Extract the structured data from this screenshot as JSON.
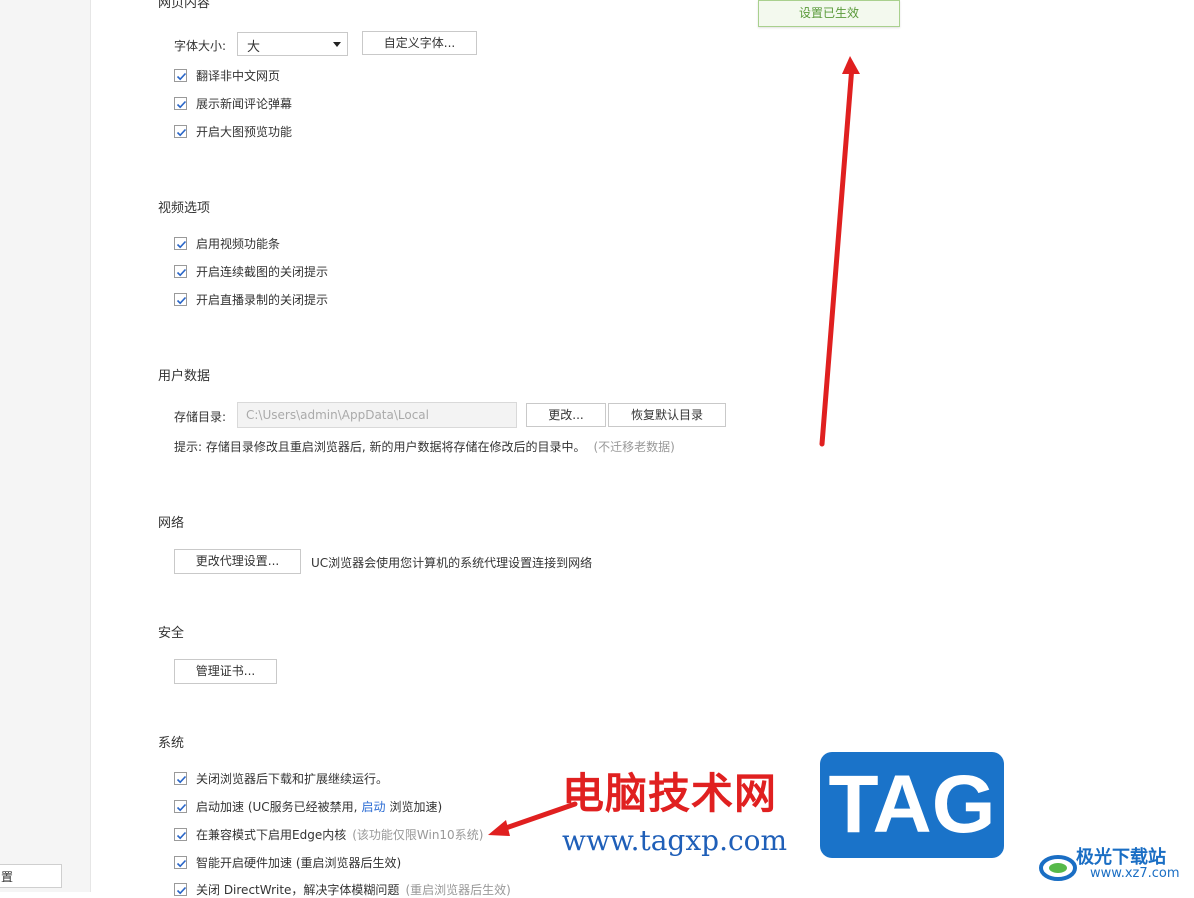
{
  "sidebar": {
    "partial_item_label": "置"
  },
  "toast": {
    "text": "设置已生效"
  },
  "web_content": {
    "title": "网页内容",
    "font_size_label": "字体大小:",
    "font_size_value": "大",
    "custom_font_button": "自定义字体...",
    "options": [
      "翻译非中文网页",
      "展示新闻评论弹幕",
      "开启大图预览功能"
    ]
  },
  "video": {
    "title": "视频选项",
    "options": [
      "启用视频功能条",
      "开启连续截图的关闭提示",
      "开启直播录制的关闭提示"
    ]
  },
  "user_data": {
    "title": "用户数据",
    "storage_label": "存储目录:",
    "storage_path": "C:\\Users\\admin\\AppData\\Local",
    "change_button": "更改...",
    "restore_button": "恢复默认目录",
    "tip": "提示: 存储目录修改且重启浏览器后, 新的用户数据将存储在修改后的目录中。",
    "tip_note": "(不迁移老数据)"
  },
  "network": {
    "title": "网络",
    "proxy_button": "更改代理设置...",
    "proxy_desc": "UC浏览器会使用您计算机的系统代理设置连接到网络"
  },
  "security": {
    "title": "安全",
    "cert_button": "管理证书..."
  },
  "system": {
    "title": "系统",
    "opt1": "关闭浏览器后下载和扩展继续运行。",
    "opt2_prefix": "启动加速 (UC服务已经被禁用,",
    "opt2_link": "启动",
    "opt2_suffix": "浏览加速)",
    "opt3": "在兼容模式下启用Edge内核",
    "opt3_note": "(该功能仅限Win10系统)",
    "opt4": "智能开启硬件加速 (重启浏览器后生效)",
    "opt5": "关闭 DirectWrite，解决字体模糊问题",
    "opt5_note": "(重启浏览器后生效)"
  },
  "watermark": {
    "cn": "电脑技术网",
    "url": "www.tagxp.com",
    "tag": "TAG",
    "site_name": "极光下载站",
    "site_url": "www.xz7.com"
  },
  "colors": {
    "arrow": "#e02020",
    "tag_blue": "#1a73c9",
    "toast_green": "#5a9a3a"
  }
}
